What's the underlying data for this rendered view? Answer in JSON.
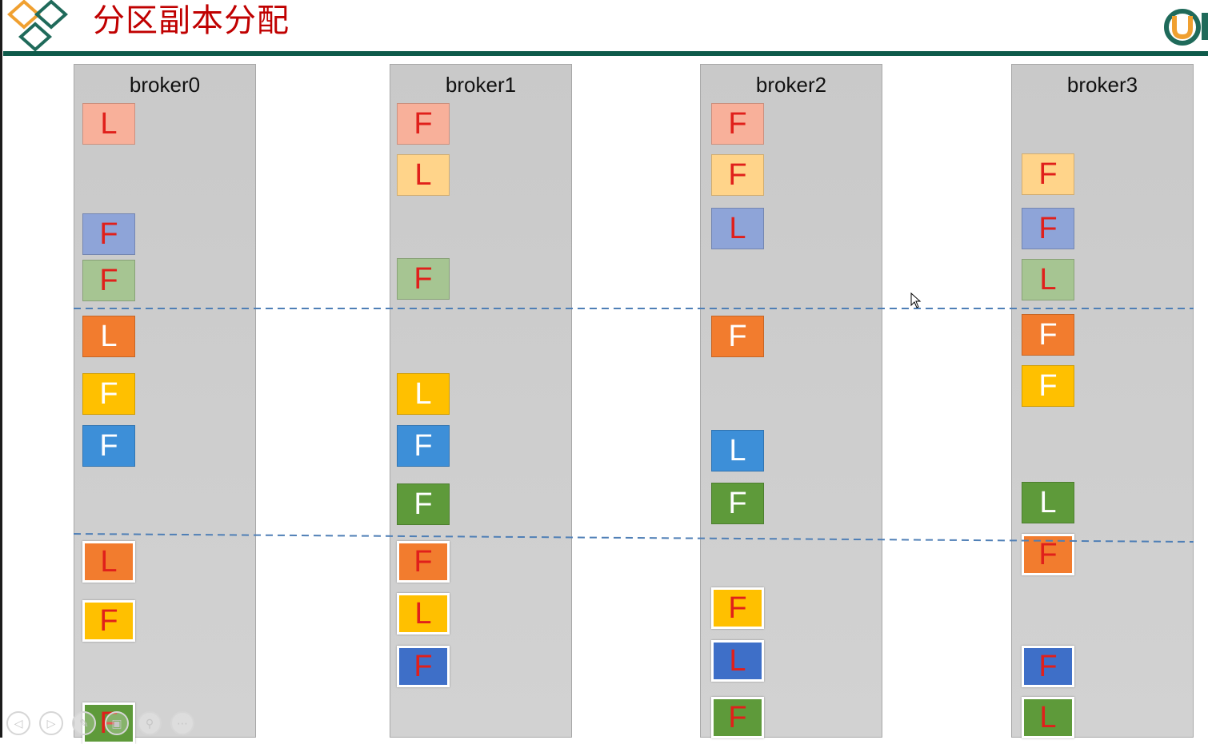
{
  "title": "分区副本分配",
  "colors": {
    "title": "#c00000",
    "rule": "#0e5a4a",
    "divider": "#4f7fb6",
    "letter_red": "#e0201b",
    "letter_white": "#ffffff"
  },
  "icons": {
    "logo": "diamond-logo-icon",
    "brand": "brand-u-icon",
    "cursor": "mouse-cursor-icon"
  },
  "slide_controls": [
    "previous-slide",
    "next-slide",
    "pen-tool",
    "slides-overview",
    "zoom",
    "more-options"
  ],
  "brokers": [
    {
      "name": "broker0",
      "replicas": [
        {
          "role": "L",
          "color": "#f8b09a"
        },
        {
          "role": "F",
          "color": "#8ea4d8"
        },
        {
          "role": "F",
          "color": "#a6c592"
        },
        {
          "role": "L",
          "color": "#f27c2e"
        },
        {
          "role": "F",
          "color": "#ffc000"
        },
        {
          "role": "F",
          "color": "#3d8fd8"
        },
        {
          "role": "L",
          "color": "#f27c2e"
        },
        {
          "role": "F",
          "color": "#ffc000"
        },
        {
          "role": "F",
          "color": "#5e9a3a"
        }
      ]
    },
    {
      "name": "broker1",
      "replicas": [
        {
          "role": "F",
          "color": "#f8b09a"
        },
        {
          "role": "L",
          "color": "#ffd48a"
        },
        {
          "role": "F",
          "color": "#a6c592"
        },
        {
          "role": "L",
          "color": "#ffc000"
        },
        {
          "role": "F",
          "color": "#3d8fd8"
        },
        {
          "role": "F",
          "color": "#5e9a3a"
        },
        {
          "role": "F",
          "color": "#f27c2e"
        },
        {
          "role": "L",
          "color": "#ffc000"
        },
        {
          "role": "F",
          "color": "#3e6fc8"
        }
      ]
    },
    {
      "name": "broker2",
      "replicas": [
        {
          "role": "F",
          "color": "#f8b09a"
        },
        {
          "role": "F",
          "color": "#ffd48a"
        },
        {
          "role": "L",
          "color": "#8ea4d8"
        },
        {
          "role": "F",
          "color": "#f27c2e"
        },
        {
          "role": "L",
          "color": "#3d8fd8"
        },
        {
          "role": "F",
          "color": "#5e9a3a"
        },
        {
          "role": "F",
          "color": "#ffc000"
        },
        {
          "role": "L",
          "color": "#3e6fc8"
        },
        {
          "role": "F",
          "color": "#5e9a3a"
        }
      ]
    },
    {
      "name": "broker3",
      "replicas": [
        {
          "role": "F",
          "color": "#ffd48a"
        },
        {
          "role": "F",
          "color": "#8ea4d8"
        },
        {
          "role": "L",
          "color": "#a6c592"
        },
        {
          "role": "F",
          "color": "#f27c2e"
        },
        {
          "role": "F",
          "color": "#ffc000"
        },
        {
          "role": "L",
          "color": "#5e9a3a"
        },
        {
          "role": "F",
          "color": "#f27c2e"
        },
        {
          "role": "F",
          "color": "#3e6fc8"
        },
        {
          "role": "L",
          "color": "#5e9a3a"
        }
      ]
    }
  ]
}
